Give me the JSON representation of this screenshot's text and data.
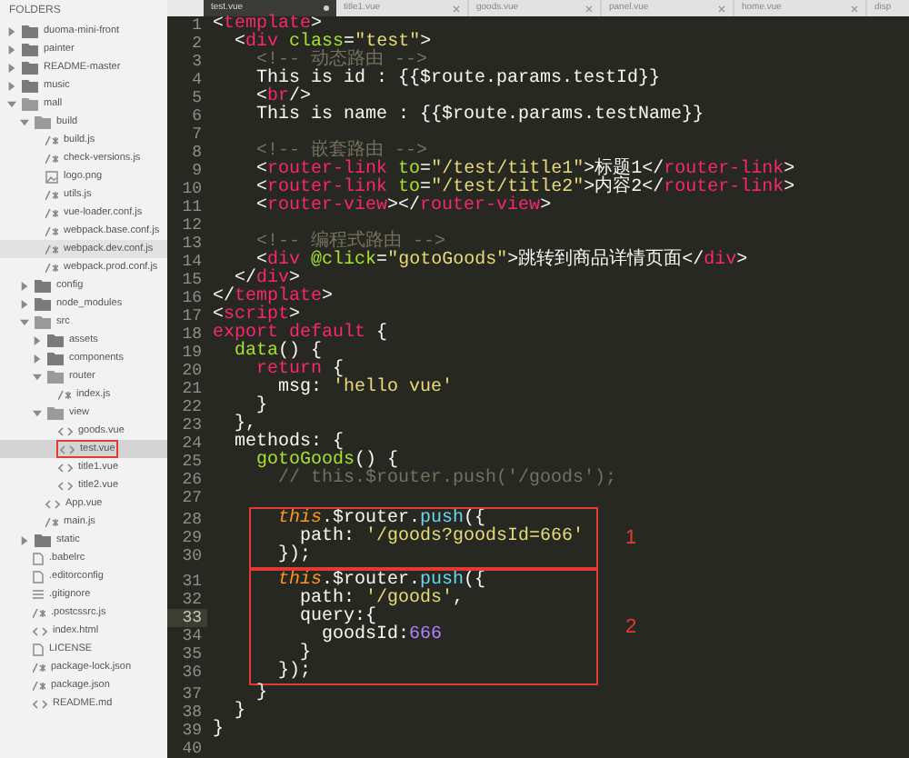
{
  "sidebar": {
    "heading": "FOLDERS",
    "tree": [
      {
        "label": "duoma-mini-front",
        "kind": "folder",
        "expanded": false,
        "selected": false,
        "hovered": false
      },
      {
        "label": "painter",
        "kind": "folder",
        "expanded": false,
        "selected": false,
        "hovered": false
      },
      {
        "label": "README-master",
        "kind": "folder",
        "expanded": false,
        "selected": false,
        "hovered": false
      },
      {
        "label": "music",
        "kind": "folder",
        "expanded": false,
        "selected": false,
        "hovered": false
      },
      {
        "label": "mall",
        "kind": "folder",
        "expanded": true,
        "selected": false,
        "hovered": false,
        "children": [
          {
            "label": "build",
            "kind": "folder",
            "expanded": true,
            "selected": false,
            "hovered": false,
            "children": [
              {
                "label": "build.js",
                "kind": "script",
                "selected": false,
                "hovered": false
              },
              {
                "label": "check-versions.js",
                "kind": "script",
                "selected": false,
                "hovered": false
              },
              {
                "label": "logo.png",
                "kind": "image",
                "selected": false,
                "hovered": false
              },
              {
                "label": "utils.js",
                "kind": "script",
                "selected": false,
                "hovered": false
              },
              {
                "label": "vue-loader.conf.js",
                "kind": "script",
                "selected": false,
                "hovered": false
              },
              {
                "label": "webpack.base.conf.js",
                "kind": "script",
                "selected": false,
                "hovered": false
              },
              {
                "label": "webpack.dev.conf.js",
                "kind": "script",
                "selected": false,
                "hovered": true
              },
              {
                "label": "webpack.prod.conf.js",
                "kind": "script",
                "selected": false,
                "hovered": false
              }
            ]
          },
          {
            "label": "config",
            "kind": "folder",
            "expanded": false,
            "selected": false,
            "hovered": false
          },
          {
            "label": "node_modules",
            "kind": "folder",
            "expanded": false,
            "selected": false,
            "hovered": false
          },
          {
            "label": "src",
            "kind": "folder",
            "expanded": true,
            "selected": false,
            "hovered": false,
            "children": [
              {
                "label": "assets",
                "kind": "folder",
                "expanded": false,
                "selected": false,
                "hovered": false
              },
              {
                "label": "components",
                "kind": "folder",
                "expanded": false,
                "selected": false,
                "hovered": false
              },
              {
                "label": "router",
                "kind": "folder",
                "expanded": true,
                "selected": false,
                "hovered": false,
                "children": [
                  {
                    "label": "index.js",
                    "kind": "script",
                    "selected": false,
                    "hovered": false
                  }
                ]
              },
              {
                "label": "view",
                "kind": "folder",
                "expanded": true,
                "selected": false,
                "hovered": false,
                "children": [
                  {
                    "label": "goods.vue",
                    "kind": "markup",
                    "selected": false,
                    "hovered": false
                  },
                  {
                    "label": "test.vue",
                    "kind": "markup",
                    "selected": true,
                    "hovered": false
                  },
                  {
                    "label": "title1.vue",
                    "kind": "markup",
                    "selected": false,
                    "hovered": false
                  },
                  {
                    "label": "title2.vue",
                    "kind": "markup",
                    "selected": false,
                    "hovered": false
                  }
                ]
              },
              {
                "label": "App.vue",
                "kind": "markup",
                "selected": false,
                "hovered": false
              },
              {
                "label": "main.js",
                "kind": "script",
                "selected": false,
                "hovered": false
              }
            ]
          },
          {
            "label": "static",
            "kind": "folder",
            "expanded": false,
            "selected": false,
            "hovered": false
          },
          {
            "label": ".babelrc",
            "kind": "plain",
            "selected": false,
            "hovered": false
          },
          {
            "label": ".editorconfig",
            "kind": "plain",
            "selected": false,
            "hovered": false
          },
          {
            "label": ".gitignore",
            "kind": "list",
            "selected": false,
            "hovered": false
          },
          {
            "label": ".postcssrc.js",
            "kind": "script",
            "selected": false,
            "hovered": false
          },
          {
            "label": "index.html",
            "kind": "markup",
            "selected": false,
            "hovered": false
          },
          {
            "label": "LICENSE",
            "kind": "plain",
            "selected": false,
            "hovered": false
          },
          {
            "label": "package-lock.json",
            "kind": "script",
            "selected": false,
            "hovered": false
          },
          {
            "label": "package.json",
            "kind": "script",
            "selected": false,
            "hovered": false
          },
          {
            "label": "README.md",
            "kind": "markup",
            "selected": false,
            "hovered": false
          }
        ]
      }
    ]
  },
  "tabs": [
    {
      "label": "test.vue",
      "selected": true,
      "modified": true
    },
    {
      "label": "title1.vue",
      "selected": false,
      "modified": false
    },
    {
      "label": "goods.vue",
      "selected": false,
      "modified": false
    },
    {
      "label": "panel.vue",
      "selected": false,
      "modified": false
    },
    {
      "label": "home.vue",
      "selected": false,
      "modified": false
    },
    {
      "label": "disp",
      "selected": false
    }
  ],
  "code": [
    {
      "lines": [
        {
          "number": "1",
          "current": false,
          "segments": [
            {
              "kind": "plain",
              "text": "<"
            },
            {
              "kind": "tag",
              "text": "template"
            },
            {
              "kind": "plain",
              "text": ">"
            }
          ]
        },
        {
          "number": "2",
          "current": false,
          "segments": [
            {
              "kind": "plain",
              "text": "  <"
            },
            {
              "kind": "tag",
              "text": "div"
            },
            {
              "kind": "attr",
              "text": " class"
            },
            {
              "kind": "plain",
              "text": "="
            },
            {
              "kind": "string",
              "text": "\"test\""
            },
            {
              "kind": "plain",
              "text": ">"
            }
          ]
        },
        {
          "number": "3",
          "current": false,
          "segments": [
            {
              "kind": "comment",
              "text": "    <!-- 动态路由 -->"
            }
          ]
        },
        {
          "number": "4",
          "current": false,
          "segments": [
            {
              "kind": "plain",
              "text": "    This is id : {{$route.params.testId}}"
            }
          ]
        },
        {
          "number": "5",
          "current": false,
          "segments": [
            {
              "kind": "plain",
              "text": "    <"
            },
            {
              "kind": "tag",
              "text": "br"
            },
            {
              "kind": "plain",
              "text": "/>"
            }
          ]
        },
        {
          "number": "6",
          "current": false,
          "segments": [
            {
              "kind": "plain",
              "text": "    This is name : {{$route.params.testName}}"
            }
          ]
        },
        {
          "number": "7",
          "current": false
        },
        {
          "number": "8",
          "current": false,
          "segments": [
            {
              "kind": "comment",
              "text": "    <!-- 嵌套路由 -->"
            }
          ]
        },
        {
          "number": "9",
          "current": false,
          "segments": [
            {
              "kind": "plain",
              "text": "    <"
            },
            {
              "kind": "tag",
              "text": "router-link"
            },
            {
              "kind": "attr",
              "text": " to"
            },
            {
              "kind": "plain",
              "text": "="
            },
            {
              "kind": "string",
              "text": "\"/test/title1\""
            },
            {
              "kind": "plain",
              "text": ">标题1</"
            },
            {
              "kind": "tag",
              "text": "router-link"
            },
            {
              "kind": "plain",
              "text": ">"
            }
          ]
        },
        {
          "number": "10",
          "current": false,
          "segments": [
            {
              "kind": "plain",
              "text": "    <"
            },
            {
              "kind": "tag",
              "text": "router-link"
            },
            {
              "kind": "attr",
              "text": " to"
            },
            {
              "kind": "plain",
              "text": "="
            },
            {
              "kind": "string",
              "text": "\"/test/title2\""
            },
            {
              "kind": "plain",
              "text": ">内容2</"
            },
            {
              "kind": "tag",
              "text": "router-link"
            },
            {
              "kind": "plain",
              "text": ">"
            }
          ]
        },
        {
          "number": "11",
          "current": false,
          "segments": [
            {
              "kind": "plain",
              "text": "    <"
            },
            {
              "kind": "tag",
              "text": "router-view"
            },
            {
              "kind": "plain",
              "text": "></"
            },
            {
              "kind": "tag",
              "text": "router-view"
            },
            {
              "kind": "plain",
              "text": ">"
            }
          ]
        },
        {
          "number": "12",
          "current": false
        },
        {
          "number": "13",
          "current": false,
          "segments": [
            {
              "kind": "comment",
              "text": "    <!-- 编程式路由 -->"
            }
          ]
        },
        {
          "number": "14",
          "current": false,
          "segments": [
            {
              "kind": "plain",
              "text": "    <"
            },
            {
              "kind": "tag",
              "text": "div"
            },
            {
              "kind": "attr",
              "text": " @click"
            },
            {
              "kind": "plain",
              "text": "="
            },
            {
              "kind": "string",
              "text": "\"gotoGoods\""
            },
            {
              "kind": "plain",
              "text": ">跳转到商品详情页面</"
            },
            {
              "kind": "tag",
              "text": "div"
            },
            {
              "kind": "plain",
              "text": ">"
            }
          ]
        },
        {
          "number": "15",
          "current": false,
          "segments": [
            {
              "kind": "plain",
              "text": "  </"
            },
            {
              "kind": "tag",
              "text": "div"
            },
            {
              "kind": "plain",
              "text": ">"
            }
          ]
        },
        {
          "number": "16",
          "current": false,
          "segments": [
            {
              "kind": "plain",
              "text": "</"
            },
            {
              "kind": "tag",
              "text": "template"
            },
            {
              "kind": "plain",
              "text": ">"
            }
          ]
        },
        {
          "number": "17",
          "current": false,
          "segments": [
            {
              "kind": "plain",
              "text": "<"
            },
            {
              "kind": "tag",
              "text": "script"
            },
            {
              "kind": "plain",
              "text": ">"
            }
          ]
        },
        {
          "number": "18",
          "current": false,
          "segments": [
            {
              "kind": "keyword",
              "text": "export default"
            },
            {
              "kind": "plain",
              "text": " {"
            }
          ]
        },
        {
          "number": "19",
          "current": false,
          "segments": [
            {
              "kind": "function",
              "text": "  data"
            },
            {
              "kind": "plain",
              "text": "() {"
            }
          ]
        },
        {
          "number": "20",
          "current": false,
          "segments": [
            {
              "kind": "keyword",
              "text": "    return"
            },
            {
              "kind": "plain",
              "text": " {"
            }
          ]
        },
        {
          "number": "21",
          "current": false,
          "segments": [
            {
              "kind": "plain",
              "text": "      msg: "
            },
            {
              "kind": "string",
              "text": "'hello vue'"
            }
          ]
        },
        {
          "number": "22",
          "current": false,
          "segments": [
            {
              "kind": "plain",
              "text": "    }"
            }
          ]
        },
        {
          "number": "23",
          "current": false,
          "segments": [
            {
              "kind": "plain",
              "text": "  },"
            }
          ]
        },
        {
          "number": "24",
          "current": false,
          "segments": [
            {
              "kind": "plain",
              "text": "  methods: {"
            }
          ]
        },
        {
          "number": "25",
          "current": false,
          "segments": [
            {
              "kind": "function",
              "text": "    gotoGoods"
            },
            {
              "kind": "plain",
              "text": "() {"
            }
          ]
        },
        {
          "number": "26",
          "current": false,
          "segments": [
            {
              "kind": "comment",
              "text": "      // this.$router.push('/goods');"
            }
          ]
        },
        {
          "number": "27",
          "current": false
        }
      ]
    },
    {
      "annotation": "1",
      "lines": [
        {
          "number": "28",
          "current": false,
          "segments": [
            {
              "kind": "this",
              "text": "      this"
            },
            {
              "kind": "plain",
              "text": ".$router."
            },
            {
              "kind": "method",
              "text": "push"
            },
            {
              "kind": "plain",
              "text": "({"
            }
          ]
        },
        {
          "number": "29",
          "current": false,
          "segments": [
            {
              "kind": "plain",
              "text": "        path: "
            },
            {
              "kind": "string",
              "text": "'/goods?goodsId=666'"
            }
          ]
        },
        {
          "number": "30",
          "current": false,
          "segments": [
            {
              "kind": "plain",
              "text": "      });"
            }
          ]
        }
      ]
    },
    {
      "annotation": "2",
      "lines": [
        {
          "number": "31",
          "current": false,
          "segments": [
            {
              "kind": "this",
              "text": "      this"
            },
            {
              "kind": "plain",
              "text": ".$router."
            },
            {
              "kind": "method",
              "text": "push"
            },
            {
              "kind": "plain",
              "text": "({"
            }
          ]
        },
        {
          "number": "32",
          "current": false,
          "segments": [
            {
              "kind": "plain",
              "text": "        path: "
            },
            {
              "kind": "string",
              "text": "'/goods'"
            },
            {
              "kind": "plain",
              "text": ","
            }
          ]
        },
        {
          "number": "33",
          "current": true,
          "segments": [
            {
              "kind": "plain",
              "text": "        query:{"
            }
          ]
        },
        {
          "number": "34",
          "current": false,
          "segments": [
            {
              "kind": "plain",
              "text": "          goodsId:"
            },
            {
              "kind": "number",
              "text": "666"
            }
          ]
        },
        {
          "number": "35",
          "current": false,
          "segments": [
            {
              "kind": "plain",
              "text": "        }"
            }
          ]
        },
        {
          "number": "36",
          "current": false,
          "segments": [
            {
              "kind": "plain",
              "text": "      });"
            }
          ]
        }
      ]
    },
    {
      "lines": [
        {
          "number": "37",
          "current": false,
          "segments": [
            {
              "kind": "plain",
              "text": "    }"
            }
          ]
        },
        {
          "number": "38",
          "current": false,
          "segments": [
            {
              "kind": "plain",
              "text": "  }"
            }
          ]
        },
        {
          "number": "39",
          "current": false,
          "segments": [
            {
              "kind": "plain",
              "text": "}"
            }
          ]
        },
        {
          "number": "40",
          "current": false
        }
      ]
    }
  ]
}
